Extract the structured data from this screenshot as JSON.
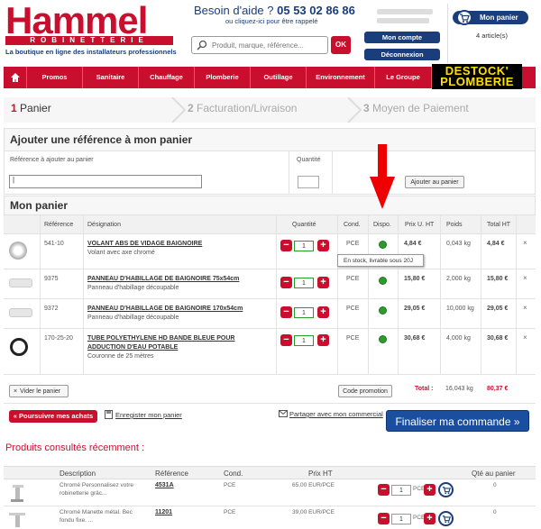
{
  "header": {
    "logo_word": "Hammel",
    "logo_sub": "ROBINETTERIE",
    "tagline": "La boutique en ligne des installateurs professionnels",
    "help_prefix": "Besoin d'aide ?",
    "help_phone": "05 53 02 86 86",
    "help_sub": "ou cliquez-ici pour être rappelé",
    "search_placeholder": "Produit, marque, référence...",
    "ok_label": "OK",
    "account_label": "Mon compte",
    "logout_label": "Déconnexion",
    "cart_label": "Mon panier",
    "cart_count": "4 article(s)"
  },
  "nav": {
    "items": [
      "Promos",
      "Sanitaire",
      "Chauffage",
      "Plomberie",
      "Outillage",
      "Environnement",
      "Le Groupe"
    ],
    "destock_line1": "DESTOCK'",
    "destock_line2": "PLOMBERIE"
  },
  "steps": [
    {
      "num": "1",
      "label": "Panier"
    },
    {
      "num": "2",
      "label": "Facturation/Livraison"
    },
    {
      "num": "3",
      "label": "Moyen de Paiement"
    }
  ],
  "add_ref": {
    "title": "Ajouter une référence à mon panier",
    "ref_label": "Référence à ajouter au panier",
    "qty_label": "Quantité",
    "ref_value": "|",
    "add_button": "Ajouter au panier"
  },
  "cart": {
    "title": "Mon panier",
    "columns": [
      "Référence",
      "Désignation",
      "Quantité",
      "Cond.",
      "Dispo.",
      "Prix U. HT",
      "Poids",
      "Total HT"
    ],
    "rows": [
      {
        "ref": "541-10",
        "name": "VOLANT ABS DE VIDAGE BAIGNOIRE",
        "desc": "Volant avec axe chromé",
        "qty": "1",
        "cond": "PCE",
        "price": "4,84 €",
        "weight": "0,043 kg",
        "total": "4,84 €"
      },
      {
        "ref": "9375",
        "name": "PANNEAU D'HABILLAGE DE BAIGNOIRE 75x54cm",
        "desc": "Panneau d'habillage découpable",
        "qty": "1",
        "cond": "PCE",
        "price": "15,80 €",
        "weight": "2,000 kg",
        "total": "15,80 €"
      },
      {
        "ref": "9372",
        "name": "PANNEAU D'HABILLAGE DE BAIGNOIRE 170x54cm",
        "desc": "Panneau d'habillage découpable",
        "qty": "1",
        "cond": "PCE",
        "price": "29,05 €",
        "weight": "10,000 kg",
        "total": "29,05 €"
      },
      {
        "ref": "170-25-20",
        "name": "TUBE POLYETHYLENE HD BANDE BLEUE POUR",
        "name2": "ADDUCTION D'EAU POTABLE",
        "desc": "Couronne de 25 mètres",
        "qty": "1",
        "cond": "PCE",
        "price": "30,68 €",
        "weight": "4,000 kg",
        "total": "30,68 €"
      }
    ],
    "tooltip": "En stock, livrable sous 20J",
    "delete_glyph": "×",
    "minus_glyph": "−",
    "plus_glyph": "+",
    "clear_button": "Vider le panier",
    "promo_button": "Code promotion",
    "total_label": "Total :",
    "total_weight": "16,043 kg",
    "total_price": "80,37 €"
  },
  "actions": {
    "continue_label": "« Poursuivre mes achats",
    "save_label": "Enregister mon panier",
    "share_label": "Partager avec mon commercial",
    "finalize_label": "Finaliser ma commande »"
  },
  "recent": {
    "title": "Produits consultés récemment :",
    "columns": [
      "Description",
      "Référence",
      "Cond.",
      "Prix HT",
      "Qté au panier"
    ],
    "rows": [
      {
        "desc1": "Chromé Personnalisez votre",
        "desc2": "robinetterie grâc...",
        "ref": "4531A",
        "cond": "PCE",
        "price": "65,00 EUR/PCE",
        "qty": "1",
        "cond2": "PCE",
        "in_cart": "0"
      },
      {
        "desc1": "Chromé Manette métal. Bec",
        "desc2": "fondu fixe. ...",
        "ref": "11201",
        "cond": "PCE",
        "price": "39,00 EUR/PCE",
        "qty": "1",
        "cond2": "PCE",
        "in_cart": "0"
      }
    ]
  },
  "colors": {
    "brand_red": "#c8102e",
    "brand_blue": "#1a3d7c",
    "stock_green": "#2e9a2e"
  }
}
